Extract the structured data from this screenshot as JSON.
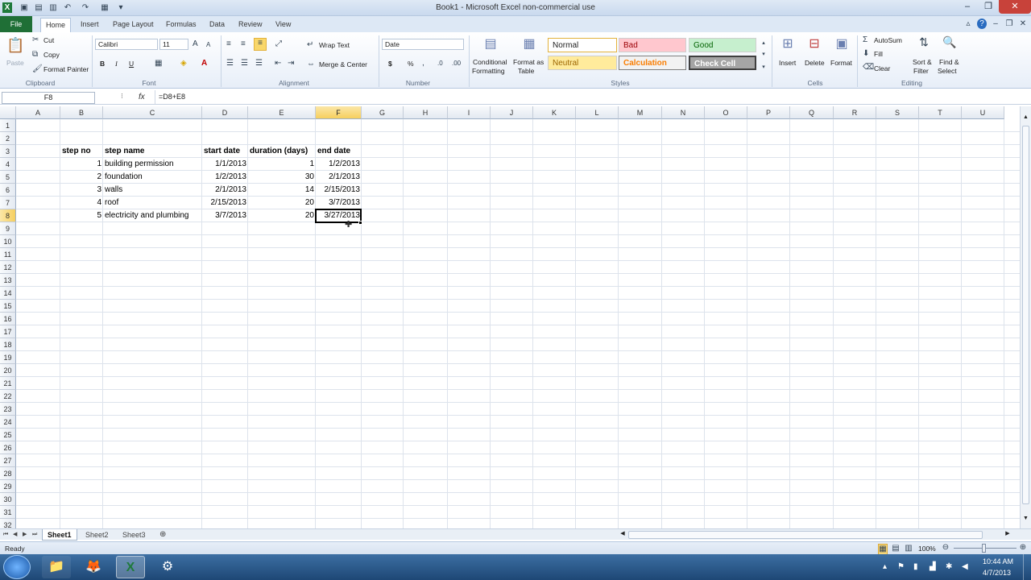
{
  "window": {
    "title": "Book1 - Microsoft Excel non-commercial use"
  },
  "tabs": [
    "File",
    "Home",
    "Insert",
    "Page Layout",
    "Formulas",
    "Data",
    "Review",
    "View"
  ],
  "ribbon": {
    "clipboard": {
      "paste": "Paste",
      "cut": "Cut",
      "copy": "Copy",
      "format_painter": "Format Painter",
      "label": "Clipboard"
    },
    "font": {
      "name": "Calibri",
      "size": "11",
      "label": "Font",
      "bold": "B",
      "italic": "I",
      "underline": "U"
    },
    "alignment": {
      "wrap": "Wrap Text",
      "merge": "Merge & Center",
      "label": "Alignment"
    },
    "number": {
      "format": "Date",
      "label": "Number",
      "currency": "$",
      "percent": "%"
    },
    "styles": {
      "conditional": "Conditional",
      "conditional2": "Formatting",
      "format_table": "Format as",
      "format_table2": "Table",
      "normal": "Normal",
      "bad": "Bad",
      "good": "Good",
      "neutral": "Neutral",
      "calculation": "Calculation",
      "check": "Check Cell",
      "label": "Styles"
    },
    "cells": {
      "insert": "Insert",
      "delete": "Delete",
      "format": "Format",
      "label": "Cells"
    },
    "editing": {
      "autosum": "AutoSum",
      "fill": "Fill",
      "clear": "Clear",
      "sort": "Sort &",
      "sort2": "Filter",
      "find": "Find &",
      "find2": "Select",
      "label": "Editing"
    }
  },
  "formula_bar": {
    "name_box": "F8",
    "fx": "fx",
    "formula": "=D8+E8"
  },
  "columns": [
    "A",
    "B",
    "C",
    "D",
    "E",
    "F",
    "G",
    "H",
    "I",
    "J",
    "K",
    "L",
    "M",
    "N",
    "O",
    "P",
    "Q",
    "R",
    "S",
    "T",
    "U"
  ],
  "rows": [
    "1",
    "2",
    "3",
    "4",
    "5",
    "6",
    "7",
    "8",
    "9",
    "10",
    "11",
    "12",
    "13",
    "14",
    "15",
    "16",
    "17",
    "18",
    "19",
    "20",
    "21",
    "22",
    "23",
    "24",
    "25",
    "26",
    "27",
    "28",
    "29",
    "30",
    "31",
    "32"
  ],
  "table": {
    "headers": [
      "step no",
      "step name",
      "start date",
      "duration (days)",
      "end date"
    ],
    "rows": [
      [
        "1",
        "building permission",
        "1/1/2013",
        "1",
        "1/2/2013"
      ],
      [
        "2",
        "foundation",
        "1/2/2013",
        "30",
        "2/1/2013"
      ],
      [
        "3",
        "walls",
        "2/1/2013",
        "14",
        "2/15/2013"
      ],
      [
        "4",
        "roof",
        "2/15/2013",
        "20",
        "3/7/2013"
      ],
      [
        "5",
        "electricity and plumbing",
        "3/7/2013",
        "20",
        "3/27/2013"
      ]
    ]
  },
  "sheets": [
    "Sheet1",
    "Sheet2",
    "Sheet3"
  ],
  "status": {
    "ready": "Ready",
    "zoom": "100%"
  },
  "taskbar": {
    "time": "10:44 AM",
    "date": "4/7/2013"
  }
}
